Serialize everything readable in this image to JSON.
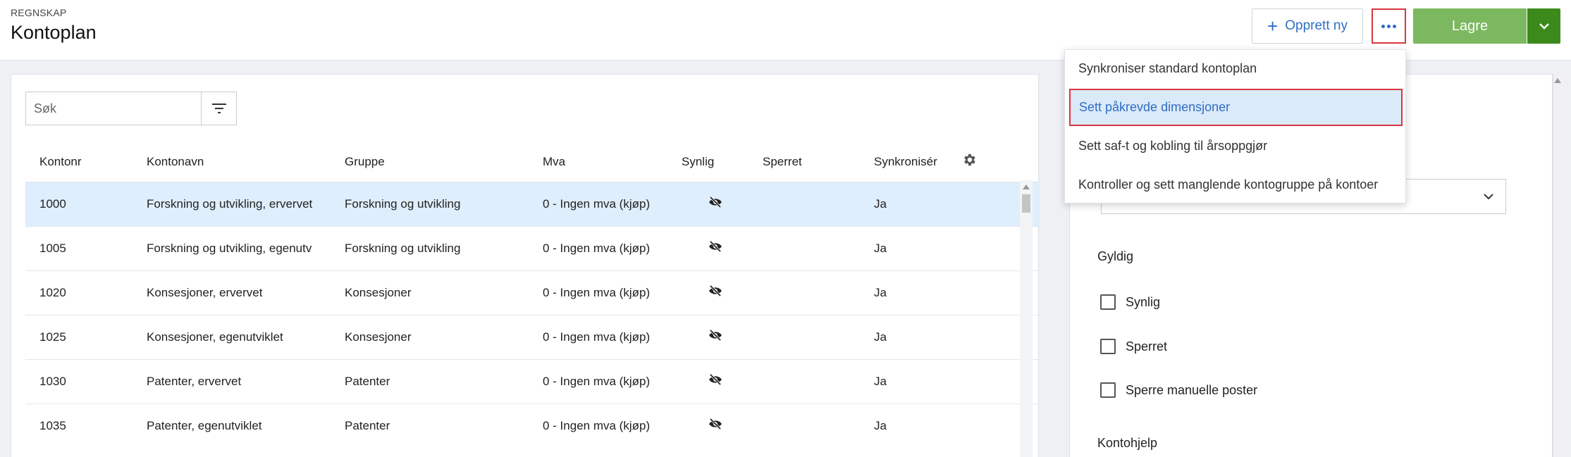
{
  "header": {
    "breadcrumb": "REGNSKAP",
    "title": "Kontoplan",
    "create_label": "Opprett ny",
    "save_label": "Lagre"
  },
  "colors": {
    "accent": "#2f6ec4",
    "save": "#7cb85f",
    "save_dark": "#3d8a1c",
    "highlight_border": "#d9363e",
    "selected_row": "#dfeefc"
  },
  "search": {
    "placeholder": "Søk"
  },
  "table": {
    "columns": [
      "Kontonr",
      "Kontonavn",
      "Gruppe",
      "Mva",
      "Synlig",
      "Sperret",
      "Synkronisér"
    ],
    "rows": [
      {
        "nr": "1000",
        "name": "Forskning og utvikling, ervervet",
        "group": "Forskning og utvikling",
        "vat": "0 - Ingen mva (kjøp)",
        "visible_icon": "eye-off-icon",
        "locked": "",
        "sync": "Ja"
      },
      {
        "nr": "1005",
        "name": "Forskning og utvikling, egenutv",
        "group": "Forskning og utvikling",
        "vat": "0 - Ingen mva (kjøp)",
        "visible_icon": "eye-off-icon",
        "locked": "",
        "sync": "Ja"
      },
      {
        "nr": "1020",
        "name": "Konsesjoner, ervervet",
        "group": "Konsesjoner",
        "vat": "0 - Ingen mva (kjøp)",
        "visible_icon": "eye-off-icon",
        "locked": "",
        "sync": "Ja"
      },
      {
        "nr": "1025",
        "name": "Konsesjoner, egenutviklet",
        "group": "Konsesjoner",
        "vat": "0 - Ingen mva (kjøp)",
        "visible_icon": "eye-off-icon",
        "locked": "",
        "sync": "Ja"
      },
      {
        "nr": "1030",
        "name": "Patenter, ervervet",
        "group": "Patenter",
        "vat": "0 - Ingen mva (kjøp)",
        "visible_icon": "eye-off-icon",
        "locked": "",
        "sync": "Ja"
      },
      {
        "nr": "1035",
        "name": "Patenter, egenutviklet",
        "group": "Patenter",
        "vat": "0 - Ingen mva (kjøp)",
        "visible_icon": "eye-off-icon",
        "locked": "",
        "sync": "Ja"
      }
    ]
  },
  "menu": {
    "items": [
      "Synkroniser standard kontoplan",
      "Sett påkrevde dimensjoner",
      "Sett saf-t og kobling til årsoppgjør",
      "Kontroller og sett manglende kontogruppe på kontoer"
    ]
  },
  "details": {
    "valid_title": "Gyldig",
    "checkboxes": [
      "Synlig",
      "Sperret",
      "Sperre manuelle poster"
    ],
    "help_title": "Kontohjelp"
  }
}
